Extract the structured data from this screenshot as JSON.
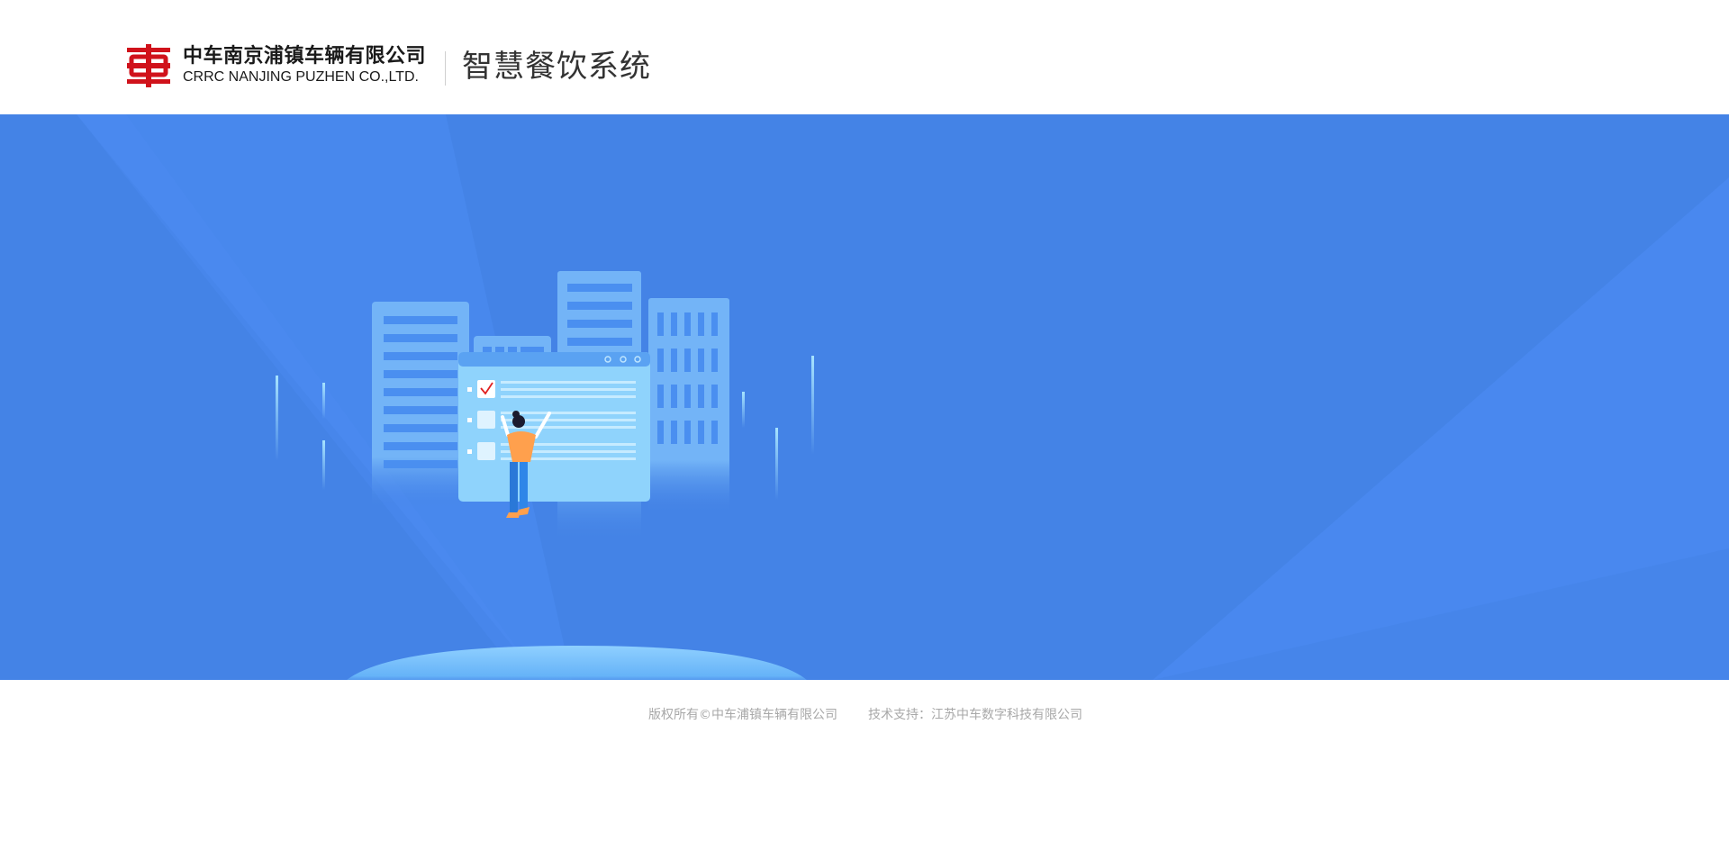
{
  "header": {
    "company_name_cn": "中车南京浦镇车辆有限公司",
    "company_name_en": "CRRC NANJING PUZHEN CO.,LTD.",
    "system_title": "智慧餐饮系统",
    "logo_icon": "crrc-logo-icon"
  },
  "footer": {
    "copyright": "版权所有©中车浦镇车辆有限公司",
    "tech_support": "技术支持：江苏中车数字科技有限公司"
  },
  "colors": {
    "brand_red": "#d0121b",
    "banner_blue": "#4483e6",
    "footer_text": "#a8a8a8"
  }
}
